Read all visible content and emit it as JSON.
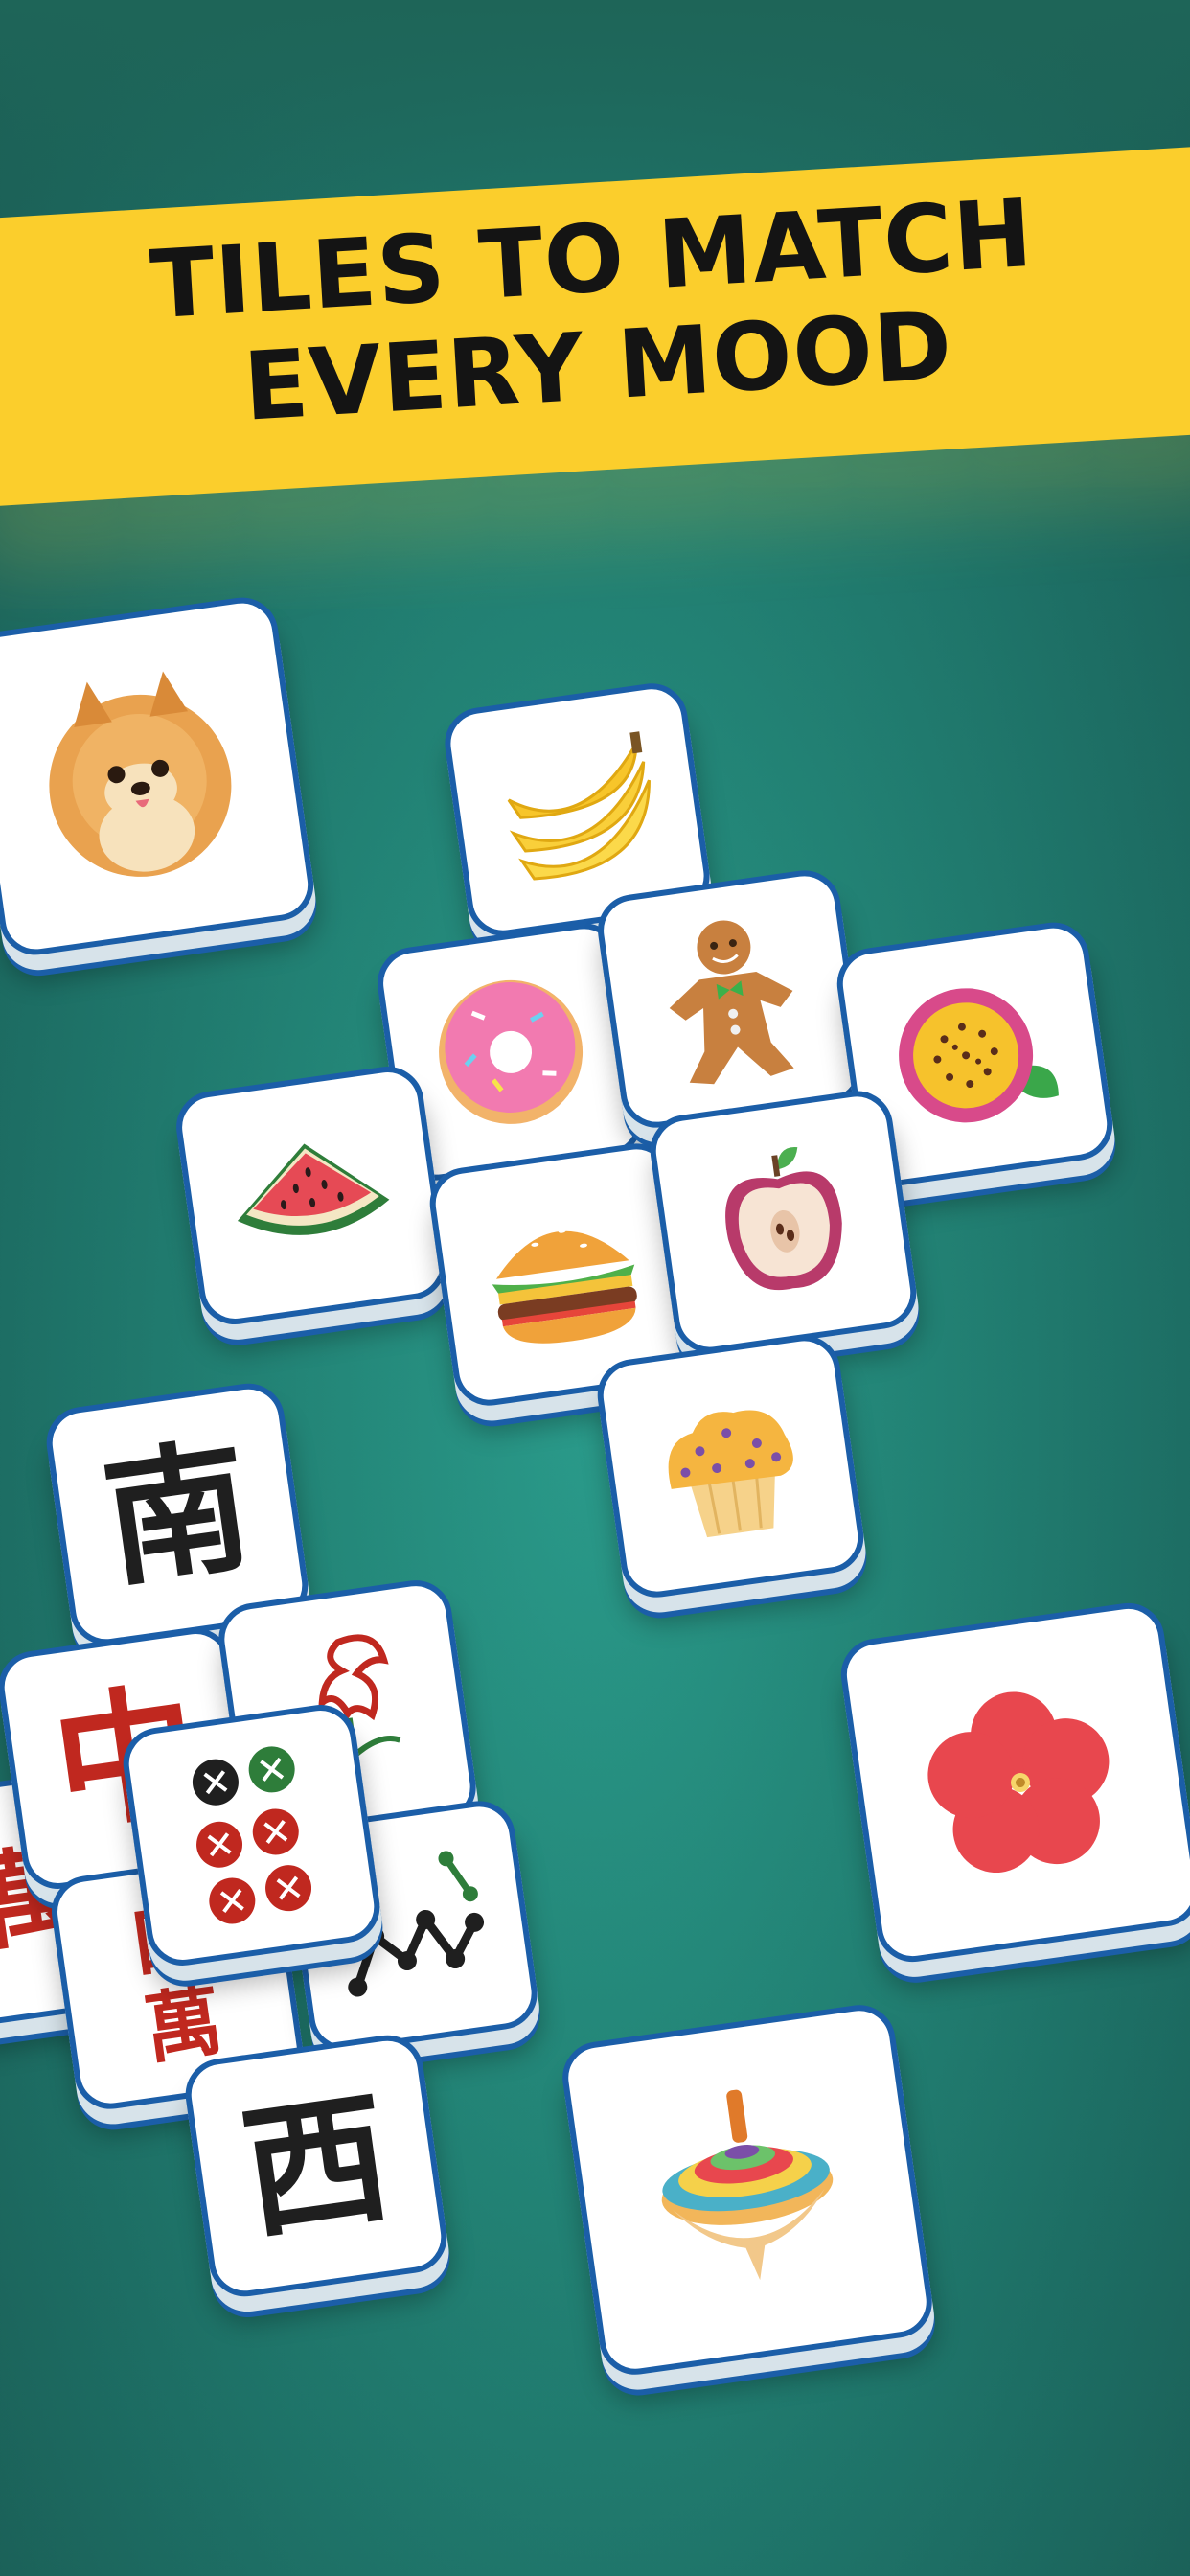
{
  "banner": {
    "line1": "TILES TO MATCH",
    "line2": "EVERY MOOD",
    "color": "#fbce2c",
    "text_color": "#141414"
  },
  "board": {
    "background": "#238577",
    "tile_face": "#ffffff",
    "tile_edge": "#1b5ea8"
  },
  "tiles": [
    {
      "name": "pomeranian-dog-icon"
    },
    {
      "name": "banana-icon"
    },
    {
      "name": "donut-icon"
    },
    {
      "name": "gingerbread-man-icon"
    },
    {
      "name": "passion-fruit-icon"
    },
    {
      "name": "watermelon-slice-icon"
    },
    {
      "name": "burger-icon"
    },
    {
      "name": "apple-half-icon"
    },
    {
      "name": "muffin-icon"
    },
    {
      "name": "red-flower-icon"
    },
    {
      "name": "spinning-top-icon"
    },
    {
      "name": "mahjong-south",
      "glyph": "南"
    },
    {
      "name": "mahjong-red-dragon",
      "glyph": "中"
    },
    {
      "name": "mahjong-wan-left",
      "glyph": "萬"
    },
    {
      "name": "mahjong-four-wan",
      "glyph": "四萬"
    },
    {
      "name": "mahjong-west",
      "glyph": "西"
    },
    {
      "name": "mahjong-bird-bamboo"
    },
    {
      "name": "mahjong-six-circles"
    },
    {
      "name": "mahjong-bamboo-sticks"
    }
  ]
}
